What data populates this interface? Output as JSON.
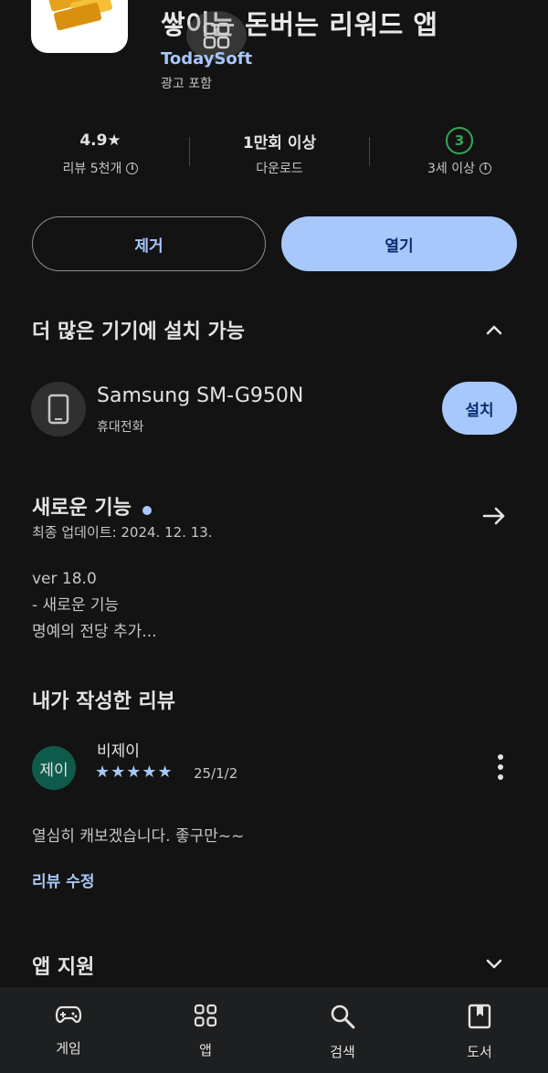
{
  "header": {
    "title": "쌓이는 돈버는 리워드 앱",
    "developer": "TodaySoft",
    "ads_label": "광고 포함"
  },
  "stats": {
    "rating": "4.9★",
    "reviews_label": "리뷰 5천개",
    "downloads": "1만회 이상",
    "downloads_label": "다운로드",
    "age_badge": "3",
    "age_label": "3세 이상"
  },
  "actions": {
    "remove": "제거",
    "open": "열기"
  },
  "devices": {
    "section_title": "더 많은 기기에 설치 가능",
    "device_name": "Samsung SM-G950N",
    "device_type": "휴대전화",
    "install": "설치"
  },
  "whats_new": {
    "title": "새로운 기능",
    "updated": "최종 업데이트: 2024. 12. 13.",
    "line1": "ver 18.0",
    "line2": "- 새로운 기능",
    "line3": "명예의 전당 추가..."
  },
  "my_review": {
    "title": "내가 작성한 리뷰",
    "avatar_text": "제이",
    "reviewer": "비제이",
    "stars": "★★★★★",
    "rating_value": 5,
    "date": "25/1/2",
    "text": "열심히 캐보겠습니다. 좋구만~~",
    "edit": "리뷰 수정"
  },
  "app_support": {
    "title": "앱 지원"
  },
  "bottom_nav": {
    "games": "게임",
    "apps": "앱",
    "search": "검색",
    "books": "도서"
  },
  "colors": {
    "background": "#131314",
    "accent": "#a8c7fa",
    "age_green": "#34a853",
    "avatar": "#0f5b4b"
  }
}
